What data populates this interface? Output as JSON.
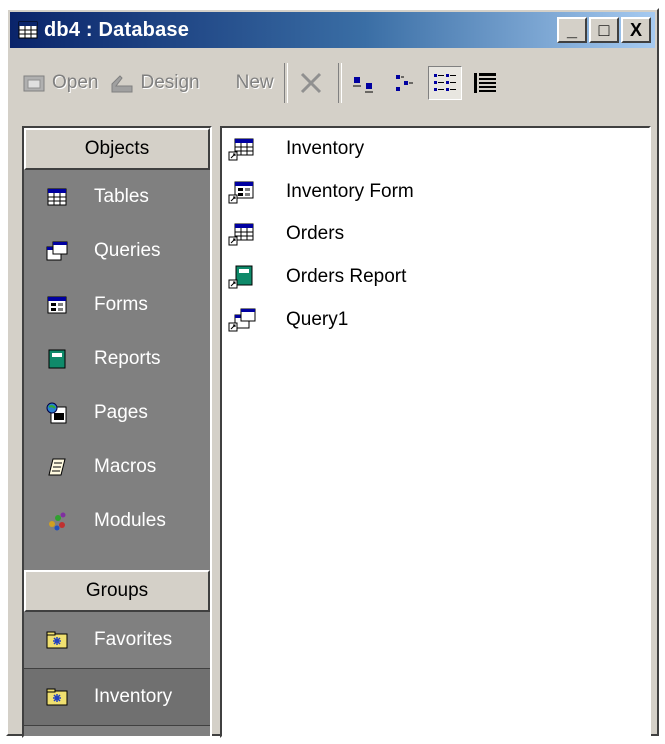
{
  "window": {
    "title": "db4 : Database",
    "controls": [
      "_",
      "□",
      "X"
    ]
  },
  "toolbar": {
    "open_label": "Open",
    "design_label": "Design",
    "new_label": "New",
    "delete_icon": "delete-x-icon",
    "views": [
      "large-icons-view-icon",
      "small-icons-view-icon",
      "list-view-icon",
      "details-view-icon"
    ],
    "active_view": "list"
  },
  "objects_bar": {
    "header": "Objects",
    "items": [
      {
        "label": "Tables",
        "icon": "table-icon"
      },
      {
        "label": "Queries",
        "icon": "query-icon"
      },
      {
        "label": "Forms",
        "icon": "form-icon"
      },
      {
        "label": "Reports",
        "icon": "report-icon"
      },
      {
        "label": "Pages",
        "icon": "page-icon"
      },
      {
        "label": "Macros",
        "icon": "macro-icon"
      },
      {
        "label": "Modules",
        "icon": "module-icon"
      }
    ]
  },
  "groups_bar": {
    "header": "Groups",
    "items": [
      {
        "label": "Favorites",
        "icon": "folder-icon"
      },
      {
        "label": "Inventory",
        "icon": "folder-icon"
      }
    ],
    "selected": "Inventory"
  },
  "list": {
    "items": [
      {
        "label": "Inventory",
        "icon": "table-shortcut-icon"
      },
      {
        "label": "Inventory Form",
        "icon": "form-shortcut-icon"
      },
      {
        "label": "Orders",
        "icon": "table-shortcut-icon"
      },
      {
        "label": "Orders Report",
        "icon": "report-shortcut-icon"
      },
      {
        "label": "Query1",
        "icon": "query-shortcut-icon"
      }
    ]
  },
  "colors": {
    "titlebar_start": "#0a246a",
    "titlebar_end": "#a6caf0",
    "face": "#d4d0c8",
    "bar_bg": "#808080"
  }
}
